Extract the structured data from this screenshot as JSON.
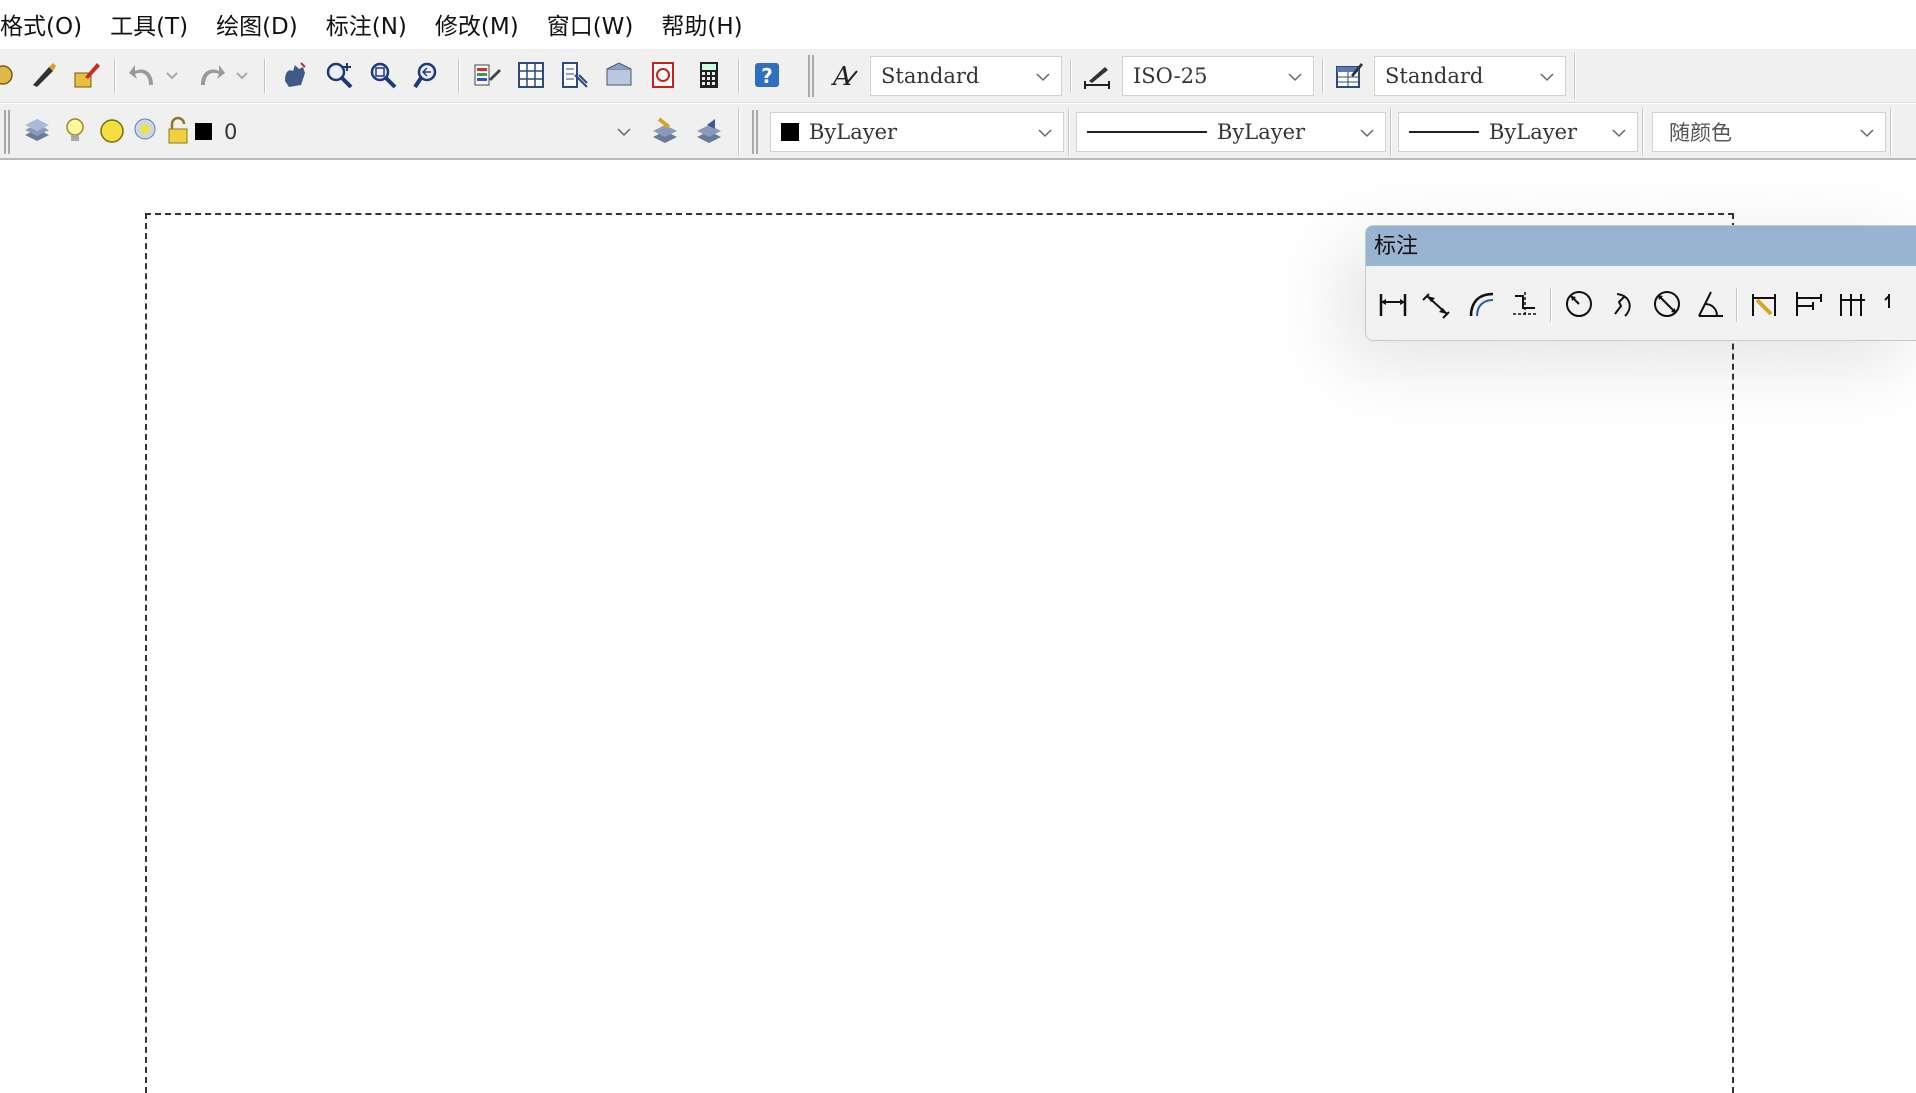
{
  "menu": [
    "格式(O)",
    "工具(T)",
    "绘图(D)",
    "标注(N)",
    "修改(M)",
    "窗口(W)",
    "帮助(H)"
  ],
  "toolbar": {
    "text_style": "Standard",
    "dim_style": "ISO-25",
    "table_style": "Standard"
  },
  "layers": {
    "current_layer": "0",
    "color": "ByLayer",
    "linetype": "ByLayer",
    "lineweight": "ByLayer",
    "plot_style": "随颜色"
  },
  "floating_toolbar": {
    "title": "标注"
  },
  "colors": {
    "toolbar_bg": "#f0f0f0",
    "titlebar_blue": "#99b4d1",
    "help_blue": "#2f6fbf"
  }
}
